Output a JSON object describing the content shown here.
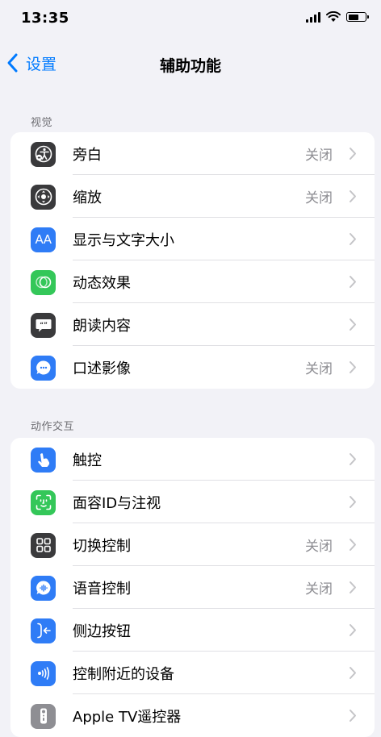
{
  "status": {
    "time": "13:35"
  },
  "nav": {
    "back_label": "设置",
    "title": "辅助功能"
  },
  "sections": [
    {
      "header": "视觉",
      "items": [
        {
          "label": "旁白",
          "value": "关闭",
          "icon": "voiceover-icon",
          "color": "#3a3a3c"
        },
        {
          "label": "缩放",
          "value": "关闭",
          "icon": "zoom-icon",
          "color": "#3a3a3c"
        },
        {
          "label": "显示与文字大小",
          "value": "",
          "icon": "text-size-icon",
          "icon_text": "AA",
          "color": "#2f7cf6"
        },
        {
          "label": "动态效果",
          "value": "",
          "icon": "motion-icon",
          "color": "#34c759"
        },
        {
          "label": "朗读内容",
          "value": "",
          "icon": "spoken-content-icon",
          "color": "#3a3a3c"
        },
        {
          "label": "口述影像",
          "value": "关闭",
          "icon": "audio-description-icon",
          "color": "#2f7cf6"
        }
      ]
    },
    {
      "header": "动作交互",
      "items": [
        {
          "label": "触控",
          "value": "",
          "icon": "touch-icon",
          "color": "#2f7cf6"
        },
        {
          "label": "面容ID与注视",
          "value": "",
          "icon": "face-id-icon",
          "color": "#34c759"
        },
        {
          "label": "切换控制",
          "value": "关闭",
          "icon": "switch-control-icon",
          "color": "#3a3a3c"
        },
        {
          "label": "语音控制",
          "value": "关闭",
          "icon": "voice-control-icon",
          "color": "#2f7cf6"
        },
        {
          "label": "侧边按钮",
          "value": "",
          "icon": "side-button-icon",
          "color": "#2f7cf6"
        },
        {
          "label": "控制附近的设备",
          "value": "",
          "icon": "nearby-devices-icon",
          "color": "#2f7cf6"
        },
        {
          "label": "Apple TV遥控器",
          "value": "",
          "icon": "apple-tv-remote-icon",
          "color": "#8e8e93"
        }
      ]
    }
  ]
}
